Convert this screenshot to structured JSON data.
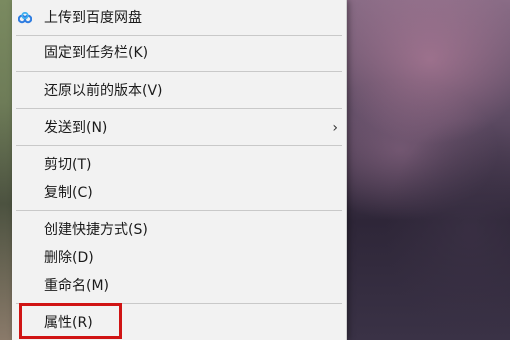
{
  "context_menu": {
    "items": [
      {
        "label": "上传到百度网盘",
        "icon": "baidu-netdisk-icon"
      },
      {
        "label": "固定到任务栏(K)"
      },
      {
        "label": "还原以前的版本(V)"
      },
      {
        "label": "发送到(N)",
        "submenu_arrow": "›"
      },
      {
        "label": "剪切(T)"
      },
      {
        "label": "复制(C)"
      },
      {
        "label": "创建快捷方式(S)"
      },
      {
        "label": "删除(D)"
      },
      {
        "label": "重命名(M)"
      },
      {
        "label": "属性(R)"
      }
    ]
  },
  "colors": {
    "menu_background": "#f2f2f2",
    "separator": "#c9c9c9",
    "highlight_border": "#d01414",
    "cloud_icon_blue": "#2f7de1"
  }
}
